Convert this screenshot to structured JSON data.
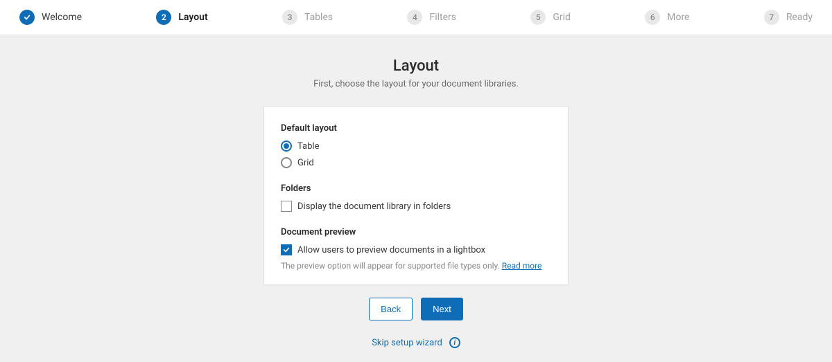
{
  "stepper": {
    "steps": [
      {
        "num": "✓",
        "label": "Welcome",
        "state": "completed"
      },
      {
        "num": "2",
        "label": "Layout",
        "state": "active"
      },
      {
        "num": "3",
        "label": "Tables",
        "state": "upcoming"
      },
      {
        "num": "4",
        "label": "Filters",
        "state": "upcoming"
      },
      {
        "num": "5",
        "label": "Grid",
        "state": "upcoming"
      },
      {
        "num": "6",
        "label": "More",
        "state": "upcoming"
      },
      {
        "num": "7",
        "label": "Ready",
        "state": "upcoming"
      }
    ]
  },
  "header": {
    "title": "Layout",
    "subtitle": "First, choose the layout for your document libraries."
  },
  "sections": {
    "defaultLayout": {
      "title": "Default layout",
      "options": {
        "table": "Table",
        "grid": "Grid"
      },
      "selected": "table"
    },
    "folders": {
      "title": "Folders",
      "checkboxLabel": "Display the document library in folders",
      "checked": false
    },
    "preview": {
      "title": "Document preview",
      "checkboxLabel": "Allow users to preview documents in a lightbox",
      "checked": true,
      "hint": "The preview option will appear for supported file types only. ",
      "hintLink": "Read more"
    }
  },
  "buttons": {
    "back": "Back",
    "next": "Next"
  },
  "footer": {
    "skip": "Skip setup wizard",
    "infoGlyph": "i"
  }
}
